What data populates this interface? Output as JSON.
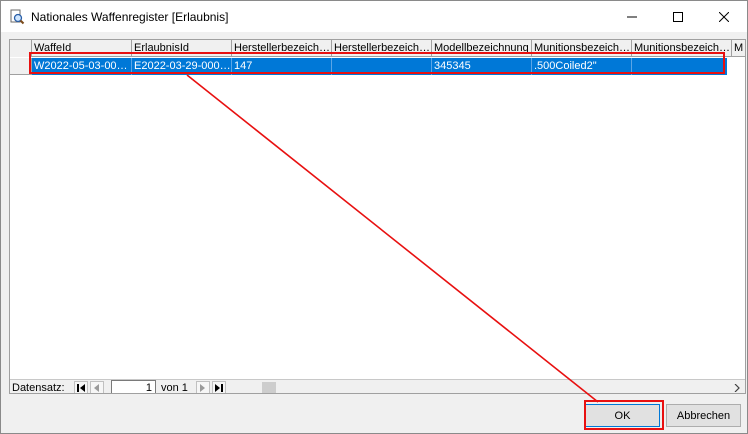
{
  "window": {
    "title": "Nationales Waffenregister [Erlaubnis]",
    "controls": {
      "minimize": "minimize",
      "maximize": "maximize",
      "close": "close"
    }
  },
  "grid": {
    "columns": [
      "WaffeId",
      "ErlaubnisId",
      "Herstellerbezeich…",
      "Herstellerbezeich…",
      "Modellbezeichnung",
      "Munitionsbezeich…",
      "Munitionsbezeich…",
      "M"
    ],
    "rows": [
      {
        "cells": [
          "W2022-05-03-00…",
          "E2022-03-29-000…",
          "147",
          "",
          "345345",
          ".500Coiled2\"",
          "",
          ""
        ],
        "selected": true
      }
    ]
  },
  "navigator": {
    "label": "Datensatz:",
    "current": "1",
    "of_text": "von 1"
  },
  "buttons": {
    "ok": "OK",
    "cancel": "Abbrechen"
  },
  "colors": {
    "selection": "#0078d7",
    "annotation": "#e81010"
  },
  "icons": {
    "app": "search-document-icon",
    "first": "first-record-icon",
    "prev": "previous-record-icon",
    "next": "next-record-icon",
    "last": "last-record-icon"
  }
}
